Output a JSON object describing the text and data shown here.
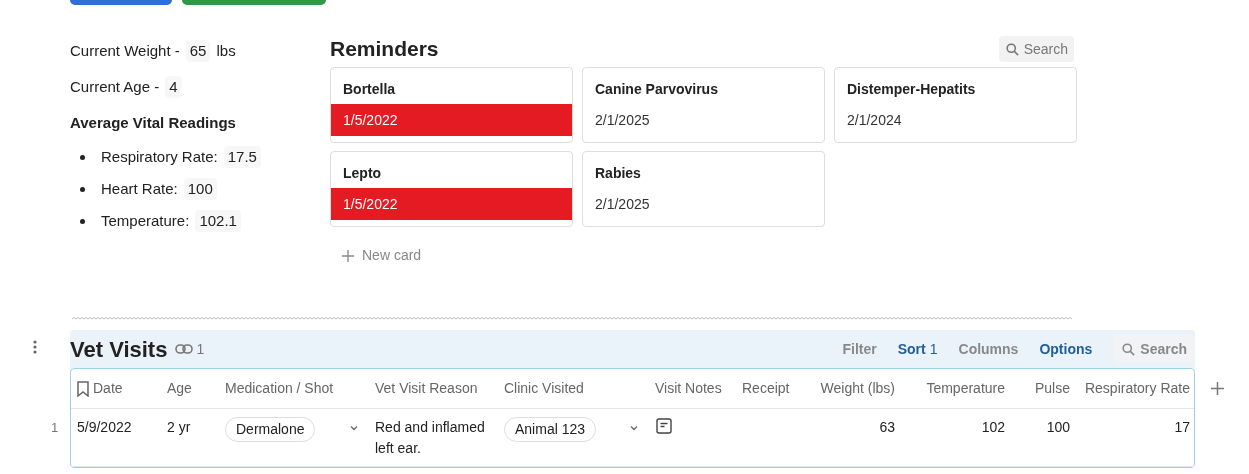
{
  "top_buttons": [
    {
      "kind": "primary"
    },
    {
      "kind": "success"
    }
  ],
  "stats": [
    {
      "label": "Current Weight -",
      "value": "65",
      "unit": "lbs"
    },
    {
      "label": "Current Age -",
      "value": "4"
    }
  ],
  "vitals": {
    "heading": "Average Vital Readings",
    "items": [
      {
        "label": "Respiratory Rate:",
        "value": "17.5"
      },
      {
        "label": "Heart Rate:",
        "value": "100"
      },
      {
        "label": "Temperature:",
        "value": "102.1"
      }
    ]
  },
  "reminders": {
    "title": "Reminders",
    "search": "Search",
    "new_card": "New card",
    "cards": [
      {
        "name": "Bortella",
        "date": "1/5/2022",
        "overdue": true
      },
      {
        "name": "Canine Parvovirus",
        "date": "2/1/2025",
        "overdue": false
      },
      {
        "name": "Distemper-Hepatits",
        "date": "2/1/2024",
        "overdue": false
      },
      {
        "name": "Lepto",
        "date": "1/5/2022",
        "overdue": true
      },
      {
        "name": "Rabies",
        "date": "2/1/2025",
        "overdue": false
      }
    ]
  },
  "vet_visits": {
    "title": "Vet Visits",
    "link_count": "1",
    "toolbar": [
      {
        "label": "Filter",
        "active": false
      },
      {
        "label": "Sort",
        "count": "1",
        "active": true
      },
      {
        "label": "Columns",
        "active": false
      },
      {
        "label": "Options",
        "active": true
      }
    ],
    "search": "Search",
    "columns": [
      {
        "label": "Date",
        "kind": "text"
      },
      {
        "label": "Age",
        "kind": "text"
      },
      {
        "label": "Medication / Shot",
        "kind": "chip"
      },
      {
        "label": "Vet Visit Reason",
        "kind": "text"
      },
      {
        "label": "Clinic Visited",
        "kind": "chip"
      },
      {
        "label": "Visit Notes",
        "kind": "note"
      },
      {
        "label": "Receipt",
        "kind": "text"
      },
      {
        "label": "Weight (lbs)",
        "kind": "number"
      },
      {
        "label": "Temperature",
        "kind": "number"
      },
      {
        "label": "Pulse",
        "kind": "number"
      },
      {
        "label": "Respiratory Rate",
        "kind": "number"
      }
    ],
    "rows": [
      {
        "number": "1",
        "cells": [
          "5/9/2022",
          "2 yr",
          "Dermalone",
          "Red and inflamed left ear.",
          "Animal 123",
          "",
          "",
          "63",
          "102",
          "100",
          "17"
        ]
      }
    ]
  }
}
